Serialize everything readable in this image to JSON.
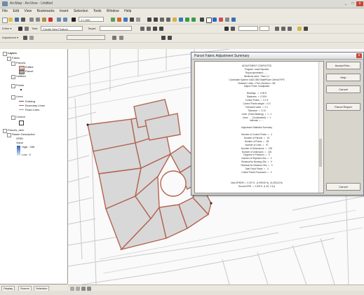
{
  "window": {
    "title": "ArcMap - ArcView - Untitled",
    "min": "_",
    "max": "□",
    "close": "x"
  },
  "menu": [
    "File",
    "Edit",
    "View",
    "Bookmarks",
    "Insert",
    "Selection",
    "Tools",
    "Window",
    "Help"
  ],
  "toolbar_primary": {
    "scale": "1:7,500"
  },
  "toolbar_editor": {
    "editor": "Editor ▾",
    "task": "Task:",
    "task_value": "Create New Feature",
    "target": "Target:"
  },
  "toolbar_adjust": {
    "label": "Adjustment ▾",
    "field": "Adjustment ▾"
  },
  "toc": {
    "items": [
      "Layers",
      "Fabric",
      "Parcels",
      "Edited",
      "Parcel",
      "Unfitted",
      "Points",
      "Lines",
      "Existing",
      "Boundary Lines",
      "Road Lines",
      "Control",
      "Parcels_dem",
      "Raster Description",
      "GRID",
      "Value",
      "High : 255",
      "Low : 0"
    ],
    "tabs": [
      "Display",
      "Source",
      "Selection"
    ]
  },
  "dialog": {
    "title": "Parcel Fabric Adjustment Summary",
    "close": "x",
    "buttons": {
      "accept": "Accept Res...",
      "help": "Help",
      "cancel": "Cancel",
      "report": "Parcel Report",
      "close": "Cancel"
    },
    "report_lines": [
      "ADJUSTMENT COMPLETED",
      "Program: Least Squares",
      "Report generated: ......",
      "Iterations used : Pass 1,2",
      "Coordinate System: NAD 1983 StatePlane Central FIPS",
      "Distance: Units = Feet, direction = NE",
      "Adjust: Fixed, Unadjusted",
      "",
      "Bearings   =  0.05 ft",
      "Distances  =  0.05 ft",
      "Control Points  =  0.1 ft",
      "Control Points weight  = 0.0",
      "Tolerance value  =  0.1",
      "Tolerance  =  0.10",
      "Lines  (Fixed Bearing)  =  1 : 1",
      "Lines  ...  (Constrained)  =  1",
      "Intervals  =  ...",
      "",
      "Adjustment Statistics Summary",
      "",
      "Number of Control Points  =   4",
      "Number of Parcels  =   15",
      "Number of Points  =   68",
      "Number of Lines  =   97",
      "Number of Dimensions  =   135",
      "Number of Unknowns  =   126",
      "Degrees of Freedom  =   9",
      "Number of Rejected Obs  =   0",
      "Residual for Bearing Obs  =   0",
      "Residual for Distance Obs  =   0",
      "Total Flood Points  =   4",
      "Linked Points Processed  =   0",
      "",
      "",
      "Max ERROR =  0.007 ft,  (1,999.50 ft),  (5,250,03 ft)",
      "Ground ERR  =  0.002 ft  (1.52, 2.41)"
    ]
  },
  "colors": {
    "parcel_fill": "#d8d8d8",
    "parcel_line": "#b4634f",
    "background_roads": "#c9c9c9",
    "dialog_bg": "#d8d5cc"
  }
}
